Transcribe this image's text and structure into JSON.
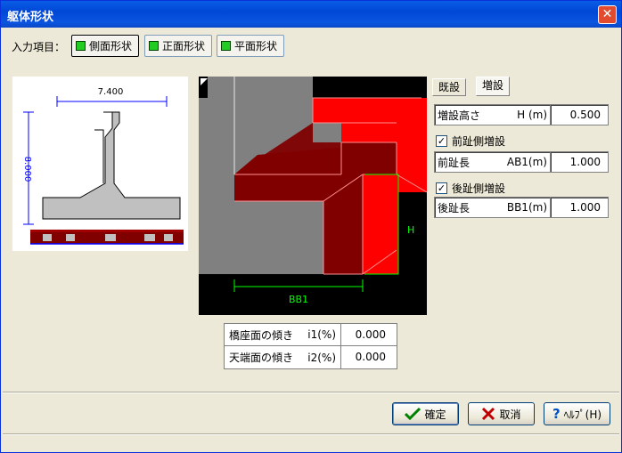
{
  "window": {
    "title": "躯体形状",
    "close_symbol": "✕"
  },
  "input_items": {
    "label": "入力項目：",
    "tabs": [
      {
        "label": "側面形状",
        "active": true
      },
      {
        "label": "正面形状",
        "active": false
      },
      {
        "label": "平面形状",
        "active": false
      }
    ]
  },
  "preview": {
    "width_dim": "7.400",
    "height_dim": "8.000"
  },
  "diagram": {
    "label_h": "H",
    "label_bb1": "BB1"
  },
  "subtabs": [
    {
      "label": "既設",
      "active": false
    },
    {
      "label": "増設",
      "active": true
    }
  ],
  "fields": {
    "h": {
      "label": "増設高さ",
      "unit": "H (m)",
      "value": "0.500"
    },
    "front_check": {
      "label": "前趾側増設",
      "checked": true
    },
    "ab1": {
      "label": "前趾長",
      "unit": "AB1(m)",
      "value": "1.000"
    },
    "rear_check": {
      "label": "後趾側増設",
      "checked": true
    },
    "bb1": {
      "label": "後趾長",
      "unit": "BB1(m)",
      "value": "1.000"
    }
  },
  "angles": [
    {
      "label": "橋座面の傾き",
      "unit": "i1(%)",
      "value": "0.000"
    },
    {
      "label": "天端面の傾き",
      "unit": "i2(%)",
      "value": "0.000"
    }
  ],
  "buttons": {
    "ok": {
      "label": "確定",
      "icon": "checkmark-icon"
    },
    "cancel": {
      "label": "取消",
      "icon": "x-icon"
    },
    "help": {
      "label": "ﾍﾙﾌﾟ(H)",
      "icon": "question-icon"
    }
  },
  "check_symbol": "✓",
  "colors": {
    "titlebar": "#0a5de6",
    "red": "#ff0000",
    "dark_red": "#800000",
    "gray": "#808080",
    "green": "#22cc22",
    "dim_blue": "#0000ff",
    "dim_green": "#00ff00"
  }
}
